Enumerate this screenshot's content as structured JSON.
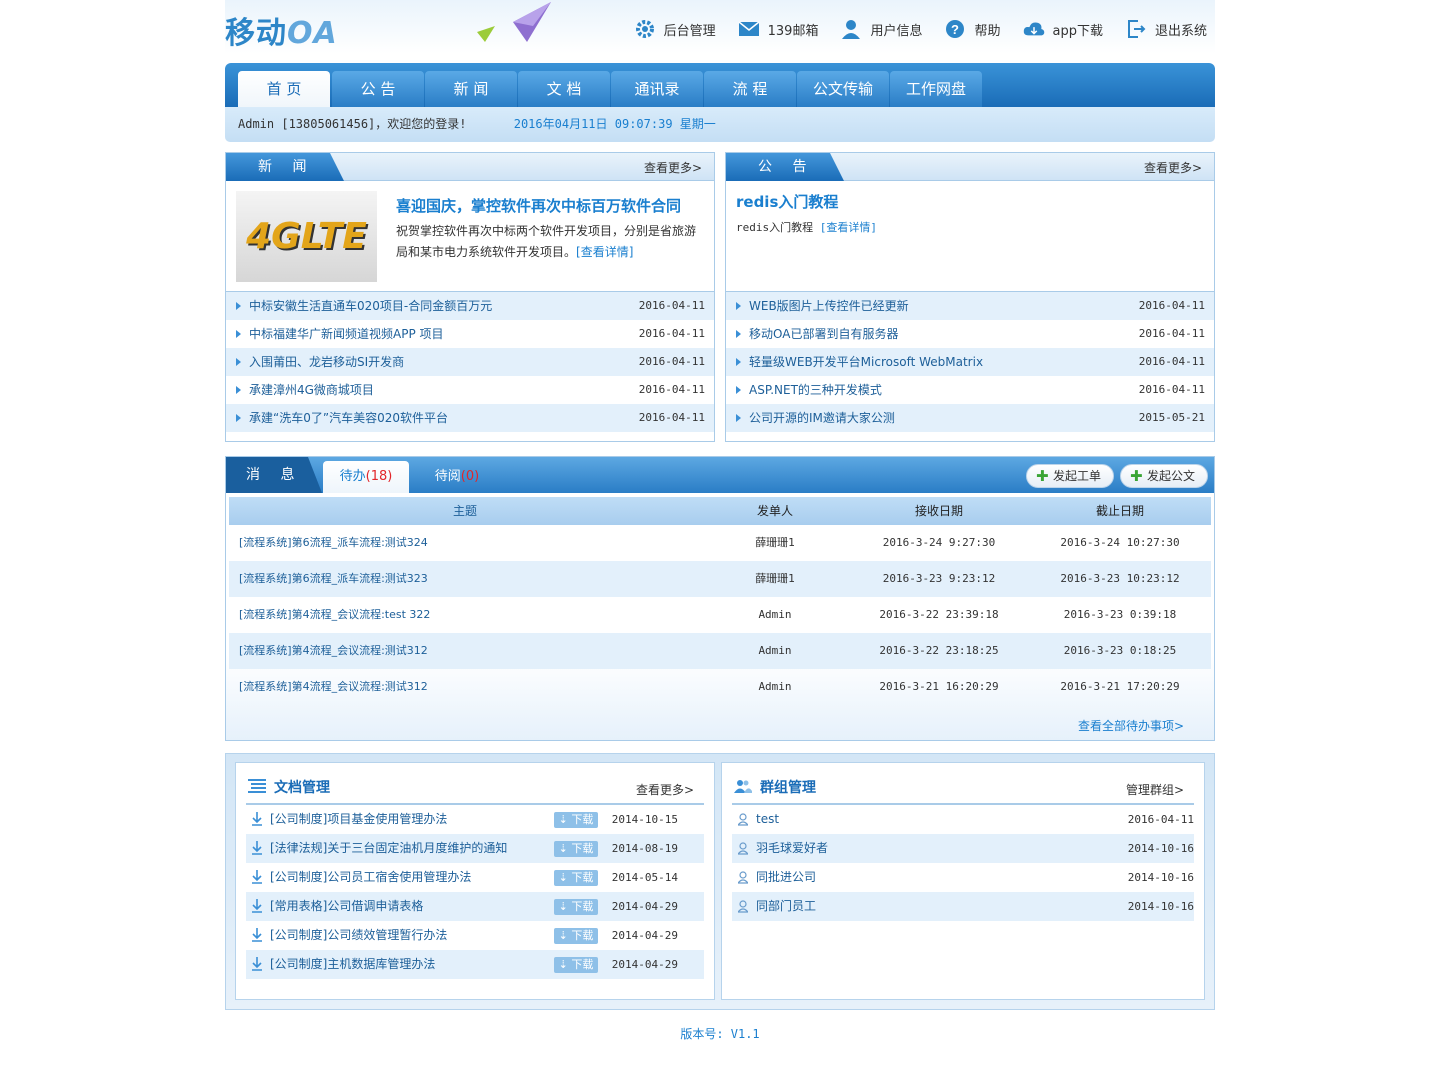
{
  "header": {
    "logo_cn": "移动",
    "logo_oa": "OA",
    "links": [
      {
        "label": "后台管理",
        "icon": "gear-icon"
      },
      {
        "label": "139邮箱",
        "icon": "mail-icon"
      },
      {
        "label": "用户信息",
        "icon": "user-icon"
      },
      {
        "label": "帮助",
        "icon": "help-icon"
      },
      {
        "label": "app下载",
        "icon": "cloud-download-icon"
      },
      {
        "label": "退出系统",
        "icon": "logout-icon"
      }
    ]
  },
  "nav": [
    "首 页",
    "公 告",
    "新 闻",
    "文 档",
    "通讯录",
    "流 程",
    "公文传输",
    "工作网盘"
  ],
  "welcome": {
    "text": "Admin [13805061456]，欢迎您的登录!",
    "datetime": "2016年04月11日 09:07:39 星期一"
  },
  "news": {
    "title": "新 闻",
    "more": "查看更多>",
    "thumb_text": "4GLTE",
    "feature_title": "喜迎国庆，掌控软件再次中标百万软件合同",
    "feature_desc": "祝贺掌控软件再次中标两个软件开发项目，分别是省旅游局和某市电力系统软件开发项目。",
    "feature_link": "[查看详情]",
    "items": [
      {
        "text": "中标安徽生活直通车020项目-合同金额百万元",
        "date": "2016-04-11"
      },
      {
        "text": "中标福建华广新闻频道视频APP 项目",
        "date": "2016-04-11"
      },
      {
        "text": "入围莆田、龙岩移动SI开发商",
        "date": "2016-04-11"
      },
      {
        "text": "承建漳州4G微商城项目",
        "date": "2016-04-11"
      },
      {
        "text": "承建“洗车0了”汽车美容020软件平台",
        "date": "2016-04-11"
      }
    ]
  },
  "notice": {
    "title": "公 告",
    "more": "查看更多>",
    "feature_title": "redis入门教程",
    "feature_desc": "redis入门教程",
    "feature_link": "[查看详情]",
    "items": [
      {
        "text": "WEB版图片上传控件已经更新",
        "date": "2016-04-11"
      },
      {
        "text": "移动OA已部署到自有服务器",
        "date": "2016-04-11"
      },
      {
        "text": "轻量级WEB开发平台Microsoft WebMatrix",
        "date": "2016-04-11"
      },
      {
        "text": "ASP.NET的三种开发模式",
        "date": "2016-04-11"
      },
      {
        "text": "公司开源的IM邀请大家公测",
        "date": "2015-05-21"
      }
    ]
  },
  "messages": {
    "title": "消 息",
    "tab_todo": "待办",
    "tab_todo_count": "(18)",
    "tab_read": "待阅",
    "tab_read_count": "(0)",
    "btn_ticket": "发起工单",
    "btn_doc": "发起公文",
    "columns": [
      "主题",
      "发单人",
      "接收日期",
      "截止日期"
    ],
    "rows": [
      [
        "[流程系统]第6流程_派车流程:测试324",
        "薛珊珊1",
        "2016-3-24 9:27:30",
        "2016-3-24 10:27:30"
      ],
      [
        "[流程系统]第6流程_派车流程:测试323",
        "薛珊珊1",
        "2016-3-23 9:23:12",
        "2016-3-23 10:23:12"
      ],
      [
        "[流程系统]第4流程_会议流程:test 322",
        "Admin",
        "2016-3-22 23:39:18",
        "2016-3-23 0:39:18"
      ],
      [
        "[流程系统]第4流程_会议流程:测试312",
        "Admin",
        "2016-3-22 23:18:25",
        "2016-3-23 0:18:25"
      ],
      [
        "[流程系统]第4流程_会议流程:测试312",
        "Admin",
        "2016-3-21 16:20:29",
        "2016-3-21 17:20:29"
      ]
    ],
    "view_all": "查看全部待办事项>"
  },
  "docs": {
    "title": "文档管理",
    "more": "查看更多>",
    "download_label": "下载",
    "items": [
      {
        "text": "[公司制度]项目基金使用管理办法",
        "date": "2014-10-15"
      },
      {
        "text": "[法律法规]关于三台固定油机月度维护的通知",
        "date": "2014-08-19"
      },
      {
        "text": "[公司制度]公司员工宿舍使用管理办法",
        "date": "2014-05-14"
      },
      {
        "text": "[常用表格]公司借调申请表格",
        "date": "2014-04-29"
      },
      {
        "text": "[公司制度]公司绩效管理暂行办法",
        "date": "2014-04-29"
      },
      {
        "text": "[公司制度]主机数据库管理办法",
        "date": "2014-04-29"
      }
    ]
  },
  "groups": {
    "title": "群组管理",
    "more": "管理群组>",
    "items": [
      {
        "text": "test",
        "date": "2016-04-11"
      },
      {
        "text": "羽毛球爱好者",
        "date": "2014-10-16"
      },
      {
        "text": "同批进公司",
        "date": "2014-10-16"
      },
      {
        "text": "同部门员工",
        "date": "2014-10-16"
      }
    ]
  },
  "footer": "版本号: V1.1",
  "colors": {
    "brand_blue": "#1a6cb7",
    "link_blue": "#1a7fcf",
    "row_alt": "#e3f0fb",
    "count_red": "#e2262a"
  }
}
